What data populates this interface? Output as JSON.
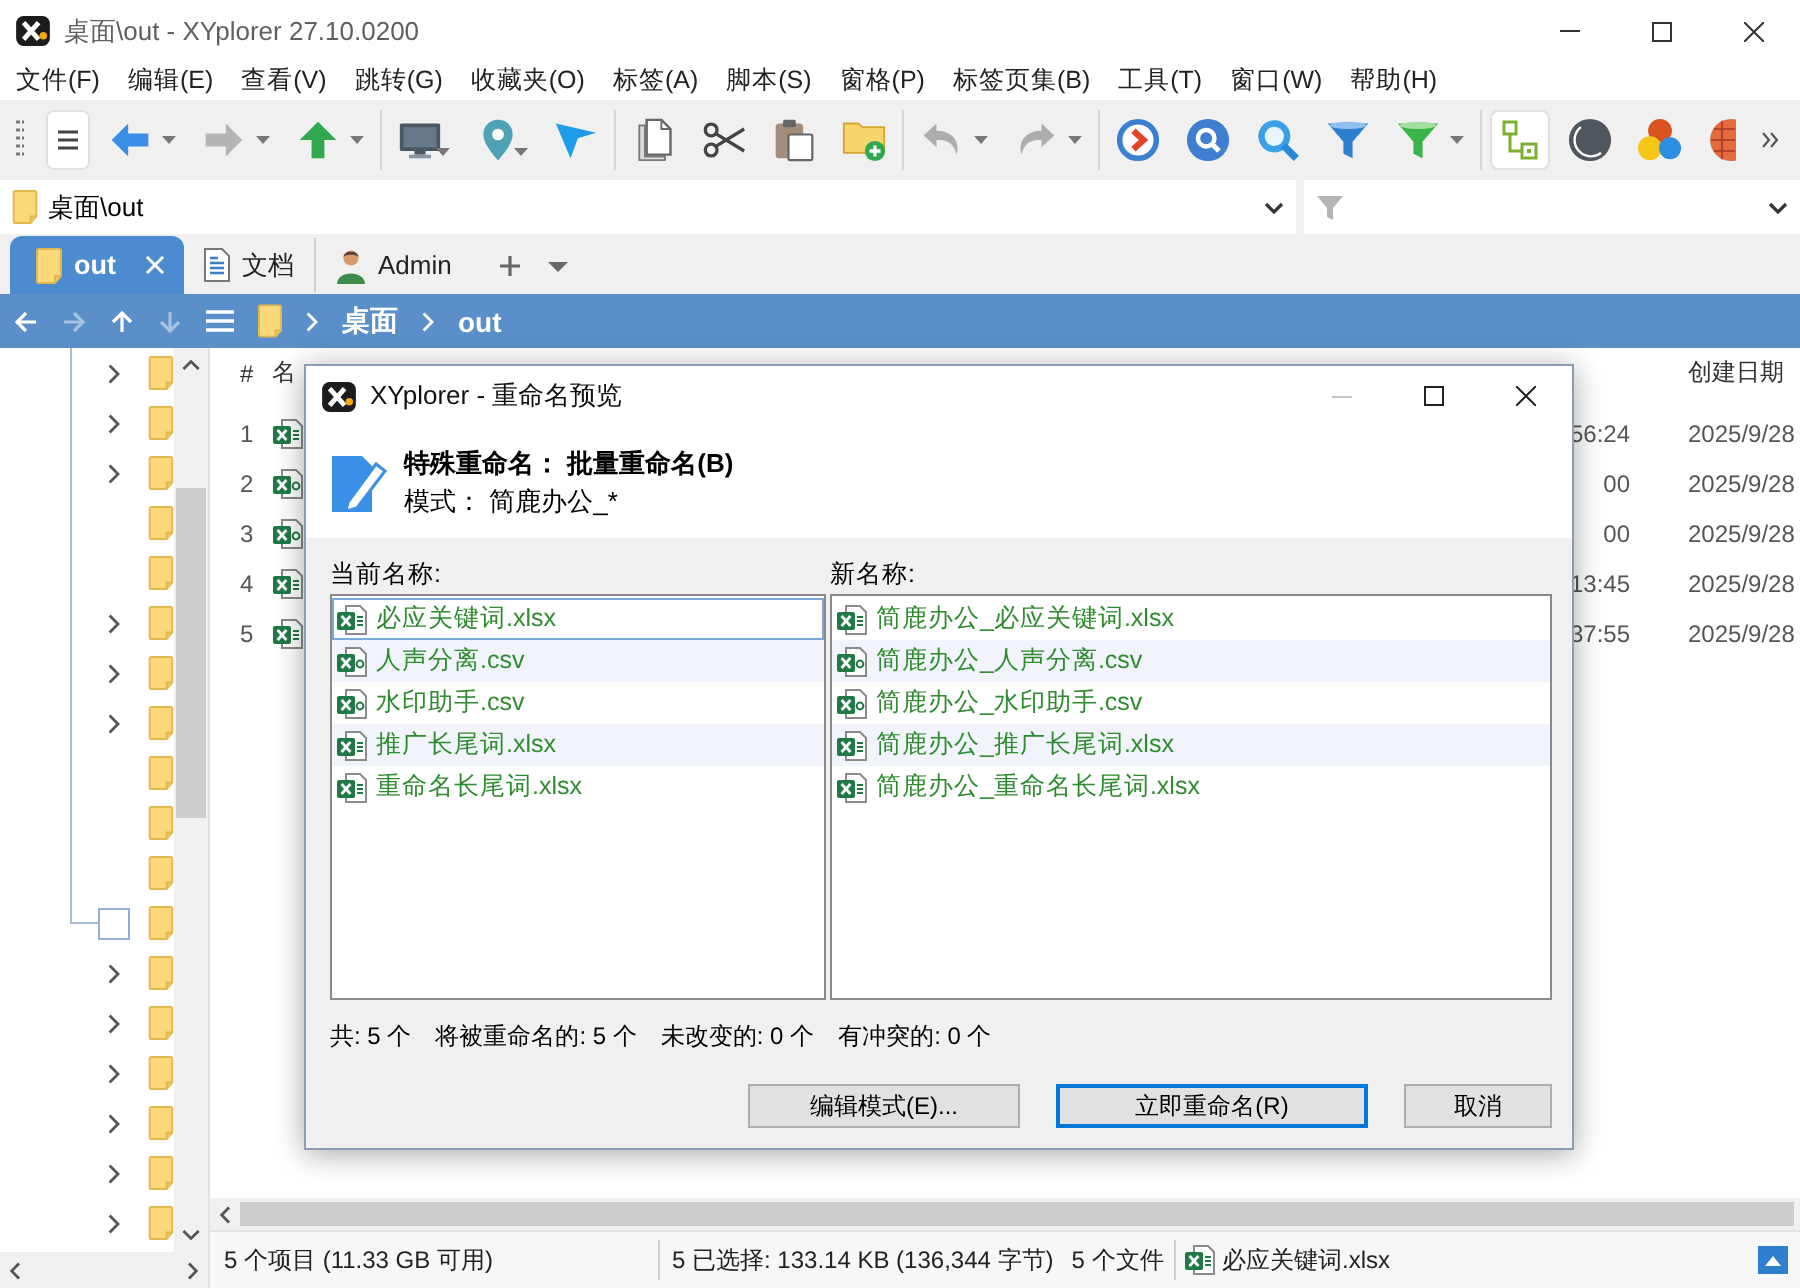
{
  "window": {
    "title": "桌面\\out - XYplorer 27.10.0200"
  },
  "menu": [
    "文件(F)",
    "编辑(E)",
    "查看(V)",
    "跳转(G)",
    "收藏夹(O)",
    "标签(A)",
    "脚本(S)",
    "窗格(P)",
    "标签页集(B)",
    "工具(T)",
    "窗口(W)",
    "帮助(H)"
  ],
  "toolbar": {
    "groups": [
      {
        "buttons": [
          {
            "kind": "menu",
            "on": true,
            "disabled": false,
            "dropdown": false
          },
          {
            "kind": "back",
            "on": false,
            "disabled": false,
            "dropdown": true
          },
          {
            "kind": "forward",
            "on": false,
            "disabled": true,
            "dropdown": true
          },
          {
            "kind": "up",
            "on": false,
            "disabled": false,
            "dropdown": true
          }
        ]
      },
      {
        "buttons": [
          {
            "kind": "computer",
            "on": false,
            "disabled": false,
            "dropdown": true
          },
          {
            "kind": "location",
            "on": false,
            "disabled": false,
            "dropdown": true
          },
          {
            "kind": "pointer",
            "on": false,
            "disabled": false,
            "dropdown": false
          }
        ]
      },
      {
        "buttons": [
          {
            "kind": "copy",
            "on": false,
            "disabled": false,
            "dropdown": false
          },
          {
            "kind": "cut",
            "on": false,
            "disabled": false,
            "dropdown": false
          },
          {
            "kind": "paste",
            "on": false,
            "disabled": false,
            "dropdown": false
          },
          {
            "kind": "new_folder",
            "on": false,
            "disabled": false,
            "dropdown": false
          }
        ]
      },
      {
        "buttons": [
          {
            "kind": "undo",
            "on": false,
            "disabled": true,
            "dropdown": true
          },
          {
            "kind": "redo",
            "on": false,
            "disabled": true,
            "dropdown": true
          }
        ]
      },
      {
        "buttons": [
          {
            "kind": "run",
            "on": false,
            "disabled": false,
            "dropdown": false
          },
          {
            "kind": "find",
            "on": false,
            "disabled": false,
            "dropdown": false
          },
          {
            "kind": "search",
            "on": false,
            "disabled": false,
            "dropdown": false
          },
          {
            "kind": "filter",
            "on": false,
            "disabled": false,
            "dropdown": false
          },
          {
            "kind": "green_filter",
            "on": false,
            "disabled": false,
            "dropdown": true
          }
        ]
      },
      {
        "buttons": [
          {
            "kind": "tree",
            "on": true,
            "disabled": false,
            "dropdown": false
          },
          {
            "kind": "dark_mode",
            "on": false,
            "disabled": false,
            "dropdown": false
          },
          {
            "kind": "colors",
            "on": false,
            "disabled": false,
            "dropdown": false
          },
          {
            "kind": "ball",
            "on": false,
            "disabled": false,
            "dropdown": false
          },
          {
            "kind": "more",
            "on": false,
            "disabled": false,
            "dropdown": false
          }
        ]
      }
    ]
  },
  "address_bar": {
    "path": "桌面\\out"
  },
  "tabs": [
    {
      "label": "out",
      "kind": "folder",
      "selected": true
    },
    {
      "label": "文档",
      "kind": "documents",
      "selected": false
    },
    {
      "label": "Admin",
      "kind": "user",
      "selected": false
    }
  ],
  "breadcrumb": {
    "nav": [
      {
        "kind": "back",
        "disabled": false
      },
      {
        "kind": "forward",
        "disabled": true
      },
      {
        "kind": "up",
        "disabled": false
      },
      {
        "kind": "down",
        "disabled": true
      }
    ],
    "path": [
      "桌面",
      "out"
    ]
  },
  "tree": {
    "items": [
      {
        "kind": "collapsed"
      },
      {
        "kind": "collapsed"
      },
      {
        "kind": "collapsed"
      },
      {
        "kind": "leaf"
      },
      {
        "kind": "leaf"
      },
      {
        "kind": "collapsed"
      },
      {
        "kind": "collapsed"
      },
      {
        "kind": "collapsed"
      },
      {
        "kind": "leaf"
      },
      {
        "kind": "leaf"
      },
      {
        "kind": "leaf"
      },
      {
        "kind": "focus"
      },
      {
        "kind": "collapsed"
      },
      {
        "kind": "collapsed"
      },
      {
        "kind": "collapsed"
      },
      {
        "kind": "collapsed"
      },
      {
        "kind": "collapsed"
      },
      {
        "kind": "collapsed"
      }
    ]
  },
  "file_list": {
    "columns": {
      "number": "#",
      "name": "名",
      "created": "创建日期"
    },
    "rows": [
      {
        "number": "1",
        "kind": "xlsx",
        "modified": "56:24",
        "created": "2025/9/28"
      },
      {
        "number": "2",
        "kind": "csv",
        "modified": "00",
        "created": "2025/9/28"
      },
      {
        "number": "3",
        "kind": "csv",
        "modified": "00",
        "created": "2025/9/28"
      },
      {
        "number": "4",
        "kind": "xlsx",
        "modified": "13:45",
        "created": "2025/9/28"
      },
      {
        "number": "5",
        "kind": "xlsx",
        "modified": "37:55",
        "created": "2025/9/28"
      }
    ]
  },
  "status_bar": {
    "items": "5 个项目 (11.33 GB 可用)",
    "selection": "5 已选择: 133.14 KB (136,344 字节)",
    "files": "5 个文件",
    "focused_file": {
      "name": "必应关键词.xlsx",
      "kind": "xlsx"
    }
  },
  "dialog": {
    "title": "XYplorer - 重命名预览",
    "controls": [
      {
        "kind": "minimize",
        "disabled": true
      },
      {
        "kind": "maximize",
        "disabled": false
      },
      {
        "kind": "close",
        "disabled": false
      }
    ],
    "heading": "特殊重命名： 批量重命名(B)",
    "pattern": "模式： 简鹿办公_*",
    "current_label": "当前名称:",
    "new_label": "新名称:",
    "current_names": [
      {
        "name": "必应关键词.xlsx",
        "kind": "xlsx",
        "focused": true
      },
      {
        "name": "人声分离.csv",
        "kind": "csv",
        "focused": false
      },
      {
        "name": "水印助手.csv",
        "kind": "csv",
        "focused": false
      },
      {
        "name": "推广长尾词.xlsx",
        "kind": "xlsx",
        "focused": false
      },
      {
        "name": "重命名长尾词.xlsx",
        "kind": "xlsx",
        "focused": false
      }
    ],
    "new_names": [
      {
        "name": "简鹿办公_必应关键词.xlsx",
        "kind": "xlsx"
      },
      {
        "name": "简鹿办公_人声分离.csv",
        "kind": "csv"
      },
      {
        "name": "简鹿办公_水印助手.csv",
        "kind": "csv"
      },
      {
        "name": "简鹿办公_推广长尾词.xlsx",
        "kind": "xlsx"
      },
      {
        "name": "简鹿办公_重命名长尾词.xlsx",
        "kind": "xlsx"
      }
    ],
    "summary": [
      "共: 5 个",
      "将被重命名的: 5 个",
      "未改变的: 0 个",
      "有冲突的: 0 个"
    ],
    "buttons": [
      {
        "label": "编辑模式(E)...",
        "default": false
      },
      {
        "label": "立即重命名(R)",
        "default": true
      },
      {
        "label": "取消",
        "default": false
      }
    ]
  }
}
